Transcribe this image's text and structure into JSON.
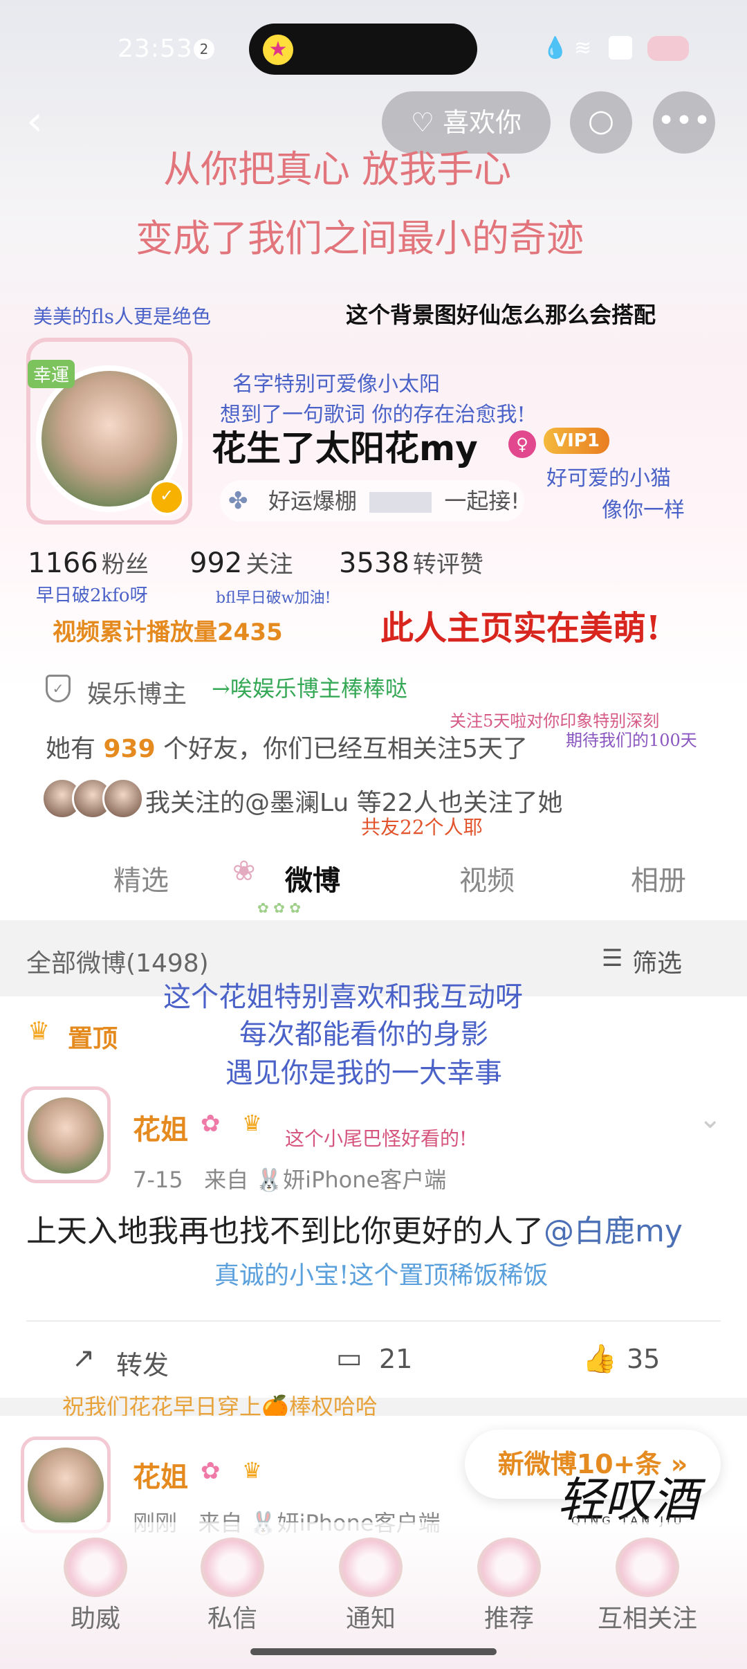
{
  "status_bar": {
    "time": "23:53",
    "notif_count": "2"
  },
  "header": {
    "like_label": "喜欢你"
  },
  "decor": {
    "line1": "从你把真心 放我手心",
    "line2": "变成了我们之间最小的奇迹",
    "left_note": "美美的fls人更是绝色",
    "right_note": "这个背景图好仙怎么那么会搭配",
    "name_note1": "名字特别可爱像小太阳",
    "name_note2": "想到了一句歌词 你的存在治愈我!",
    "cat_note1": "好可爱的小猫",
    "cat_note2": "像你一样",
    "fans_note": "早日破2kfo呀",
    "follow_note": "bfl早日破w加油!",
    "cute_note": "此人主页实在美萌!",
    "category_note": "→唉娱乐博主棒棒哒",
    "days_note1": "关注5天啦对你印象特别深刻",
    "days_note2": "期待我们的100天",
    "mutual_note": "共友22个人耶",
    "pin_note1": "这个花姐特别喜欢和我互动呀",
    "pin_note2": "每次都能看你的身影",
    "pin_note3": "遇见你是我的一大幸事",
    "tail_note": "这个小尾巴怪好看的!",
    "post_note": "真诚的小宝!这个置顶稀饭稀饭",
    "wish_note": "祝我们花花早日穿上🍊棒权哈哈",
    "lucky": "幸運"
  },
  "profile": {
    "name": "花生了太阳花my",
    "vip": "VIP1",
    "signature_a": "好运爆棚",
    "signature_b": "一起接!",
    "fans_count": "1166",
    "fans_label": "粉丝",
    "follow_count": "992",
    "follow_label": "关注",
    "likes_count": "3538",
    "likes_label": "转评赞",
    "play_count": "视频累计播放量2435",
    "category": "娱乐博主",
    "friends_pre": "她有",
    "friends_num": "939",
    "friends_post": "个好友，你们已经互相关注5天了",
    "mutual": "我关注的@墨澜Lu 等22人也关注了她"
  },
  "tabs": [
    "精选",
    "微博",
    "视频",
    "相册"
  ],
  "feed": {
    "all_label": "全部微博(1498)",
    "filter_label": "筛选",
    "pin_label": "置顶"
  },
  "post1": {
    "name": "花姐",
    "date": "7-15",
    "source": "来自",
    "client": "妍iPhone客户端",
    "text": "上天入地我再也找不到比你更好的人了",
    "mention": "@白鹿my",
    "repost": "转发",
    "comments": "21",
    "likes": "35"
  },
  "post2": {
    "name": "花姐",
    "time": "刚刚",
    "source": "来自",
    "client": "妍iPhone客户端"
  },
  "new_posts": "新微博10+条",
  "watermark": "轻叹酒",
  "watermark_sub": "QING TAN JIU",
  "bottom_nav": [
    "助威",
    "私信",
    "通知",
    "推荐",
    "互相关注"
  ]
}
